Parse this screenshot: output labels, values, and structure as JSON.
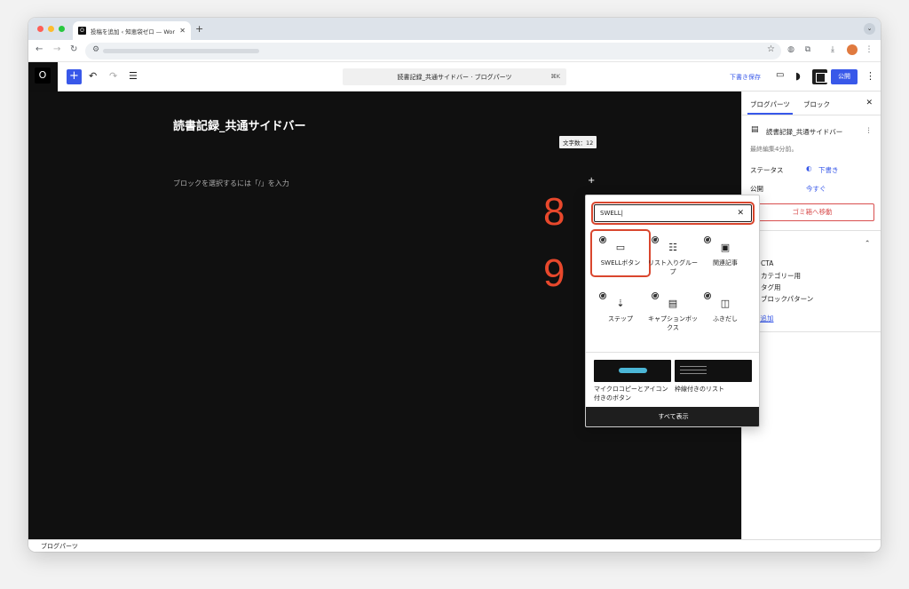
{
  "browser": {
    "tab_title": "投稿を追加 ‹ 知恵袋ゼロ — Wor…",
    "tab_favicon": "O"
  },
  "editor": {
    "logo": "O",
    "command_bar": "読書記録_共通サイドバー · ブログパーツ",
    "command_shortcut": "⌘K",
    "save_draft": "下書き保存",
    "publish": "公開"
  },
  "canvas": {
    "post_title": "読書記録_共通サイドバー",
    "word_count": "文字数：12",
    "placeholder": "ブロックを選択するには「/」を入力",
    "step_numbers": [
      "8",
      "9"
    ]
  },
  "inserter": {
    "search_value": "SWELL|",
    "blocks": [
      {
        "label": "SWELLボタン",
        "icon": "button-icon"
      },
      {
        "label": "リスト入りグループ",
        "icon": "list-icon"
      },
      {
        "label": "関連記事",
        "icon": "post-link-icon"
      },
      {
        "label": "ステップ",
        "icon": "steps-icon"
      },
      {
        "label": "キャプションボックス",
        "icon": "caption-box-icon"
      },
      {
        "label": "ふきだし",
        "icon": "balloon-icon"
      }
    ],
    "patterns": [
      {
        "label": "マイクロコピーとアイコン付きのボタン"
      },
      {
        "label": "枠線付きのリスト"
      }
    ],
    "browse_all": "すべて表示"
  },
  "sidebar": {
    "tabs": [
      "ブログパーツ",
      "ブロック"
    ],
    "doc_title": "読書記録_共通サイドバー",
    "last_edited": "最終編集4分前。",
    "status_label": "ステータス",
    "status_value": "下書き",
    "publish_label": "公開",
    "publish_value": "今すぐ",
    "trash": "ゴミ箱へ移動",
    "terms": [
      "CTA",
      "カテゴリー用",
      "タグ用",
      "ブロックパターン"
    ],
    "add_term": "を追加"
  },
  "statusbar": {
    "breadcrumb": "ブログパーツ"
  },
  "colors": {
    "accent": "#3858e9",
    "highlight": "#d9462e",
    "canvas": "#101010"
  }
}
